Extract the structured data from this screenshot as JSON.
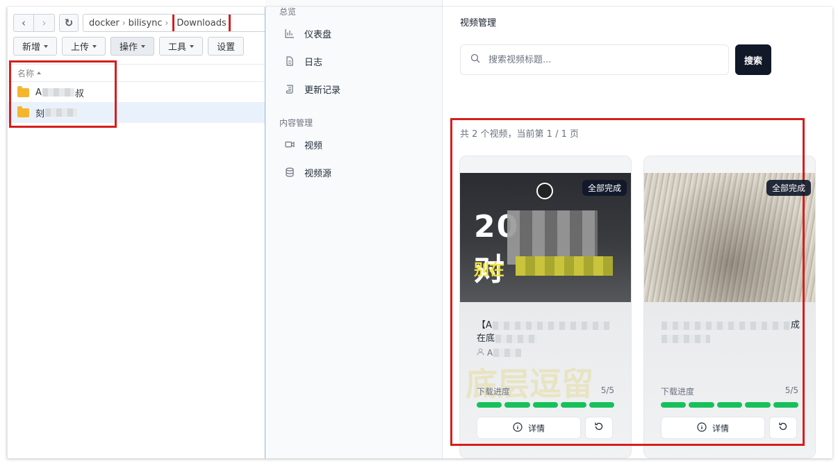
{
  "file_station": {
    "path": [
      "docker",
      "bilisync"
    ],
    "current_folder": "Downloads",
    "toolbar": [
      {
        "label": "新增",
        "caret": true
      },
      {
        "label": "上传",
        "caret": true
      },
      {
        "label": "操作",
        "caret": true
      },
      {
        "label": "工具",
        "caret": true
      },
      {
        "label": "设置",
        "caret": false
      }
    ],
    "column_name": "名称",
    "rows": [
      {
        "prefix": "A",
        "suffix": "叔"
      },
      {
        "prefix": "刻",
        "suffix": ""
      }
    ]
  },
  "sidebar": {
    "section_overview": "总览",
    "overview_items": [
      {
        "label": "仪表盘",
        "icon": "bar-chart-icon"
      },
      {
        "label": "日志",
        "icon": "document-icon"
      },
      {
        "label": "更新记录",
        "icon": "scroll-icon"
      }
    ],
    "section_content": "内容管理",
    "content_items": [
      {
        "label": "视频",
        "icon": "video-icon"
      },
      {
        "label": "视频源",
        "icon": "database-icon"
      }
    ]
  },
  "main": {
    "title": "视频管理",
    "search_placeholder": "搜索视频标题...",
    "search_button": "搜索",
    "count_text": "共 2 个视频，当前第 1 / 1 页",
    "cards": [
      {
        "badge": "全部完成",
        "title_start": "【A",
        "title_line2": "在底",
        "author_initial": "A",
        "progress_label": "下载进度",
        "progress_count": "5/5",
        "progress_done": 5,
        "progress_total": 5,
        "detail_label": "详情",
        "thumb_big": "20",
        "thumb_big_end": "对",
        "thumb_yellow": "别在",
        "watermark": "底层逗留"
      },
      {
        "badge": "全部完成",
        "title_start": "",
        "title_end": "成",
        "progress_label": "下载进度",
        "progress_count": "5/5",
        "progress_done": 5,
        "progress_total": 5,
        "detail_label": "详情"
      }
    ]
  },
  "colors": {
    "highlight": "#d61d1d",
    "progress": "#16c15b",
    "dark_button": "#111827"
  }
}
